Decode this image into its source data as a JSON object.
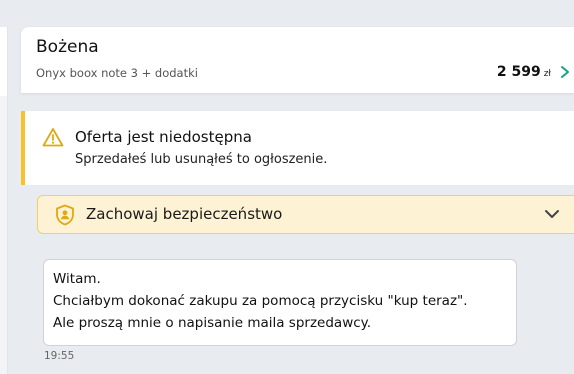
{
  "header": {
    "name": "Bożena",
    "listing": "Onyx boox note 3 + dodatki",
    "price": "2 599",
    "currency": "zł",
    "chevron_icon": "chevron-right-icon",
    "accent_color": "#14a58a"
  },
  "notice": {
    "title": "Oferta jest niedostępna",
    "text": "Sprzedałeś lub usunąłeś to ogłoszenie.",
    "icon": "warning-triangle-icon",
    "accent_color": "#f5c22b"
  },
  "safety_banner": {
    "label": "Zachowaj bezpieczeństwo",
    "icon": "shield-person-icon",
    "toggle_icon": "chevron-down-icon",
    "background_color": "#fdf3d4"
  },
  "messages": [
    {
      "lines": [
        "Witam.",
        "Chciałbym dokonać zakupu za pomocą przycisku \"kup teraz\".",
        "Ale proszą mnie o napisanie maila sprzedawcy."
      ],
      "time": "19:55"
    }
  ]
}
